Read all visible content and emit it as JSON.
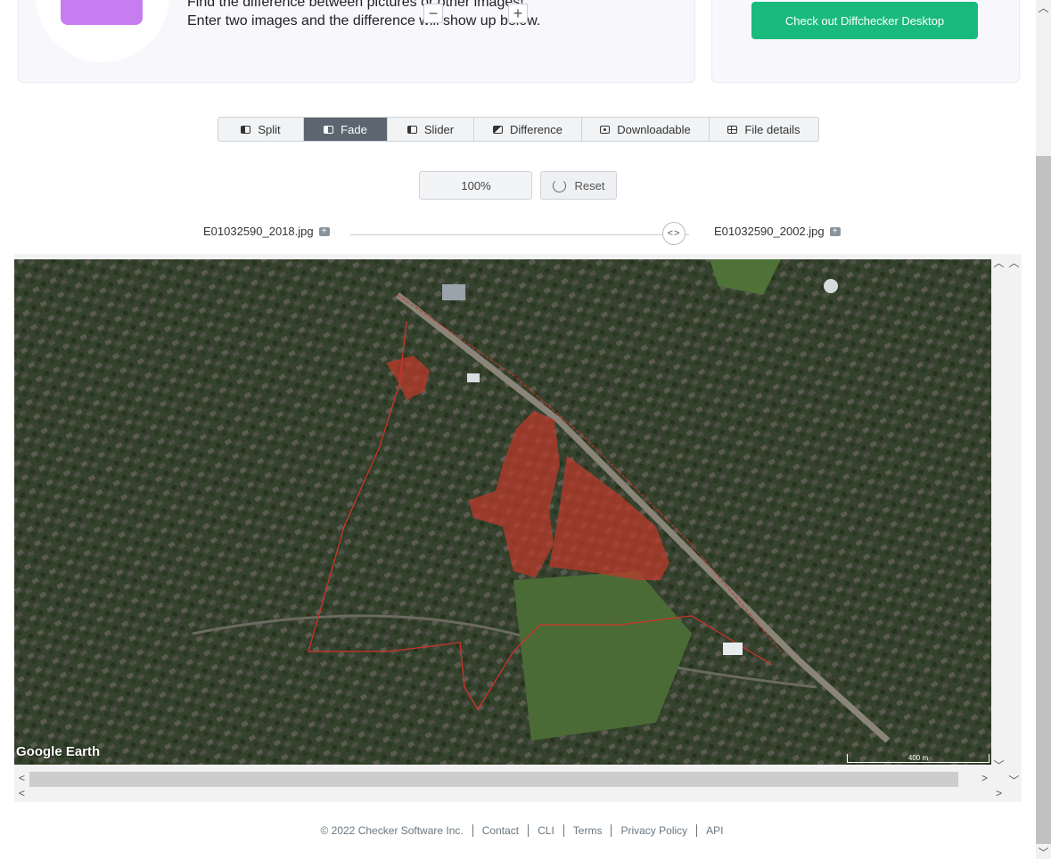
{
  "intro": {
    "line1": "Find the difference between pictures or other images!",
    "line2": "Enter two images and the difference will show up below."
  },
  "desktop_button": "Check out Diffchecker Desktop",
  "tabs": [
    {
      "label": "Split",
      "icon": "split-icon",
      "active": false
    },
    {
      "label": "Fade",
      "icon": "fade-icon",
      "active": true
    },
    {
      "label": "Slider",
      "icon": "slider-icon",
      "active": false
    },
    {
      "label": "Difference",
      "icon": "difference-icon",
      "active": false
    },
    {
      "label": "Downloadable",
      "icon": "download-image-icon",
      "active": false
    },
    {
      "label": "File details",
      "icon": "file-details-icon",
      "active": false
    }
  ],
  "zoom": {
    "minus": "−",
    "value": "100%",
    "plus": "+",
    "reset_label": "Reset"
  },
  "files": {
    "left": "E01032590_2018.jpg",
    "right": "E01032590_2002.jpg"
  },
  "slider_thumb": "<>",
  "image": {
    "watermark": "Google Earth",
    "scale": "400 m",
    "highlight_color": "#c0392b"
  },
  "footer": {
    "copyright": "© 2022 Checker Software Inc.",
    "links": [
      "Contact",
      "CLI",
      "Terms",
      "Privacy Policy",
      "API"
    ]
  },
  "colors": {
    "accent_green": "#1aba7d",
    "active_tab": "#5b6670"
  }
}
